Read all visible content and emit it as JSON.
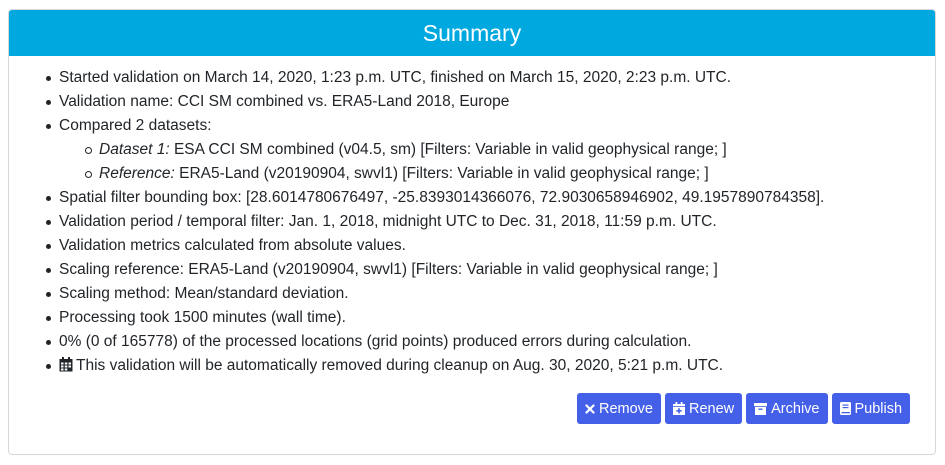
{
  "header": {
    "title": "Summary"
  },
  "summary": {
    "started": "Started validation on March 14, 2020, 1:23 p.m. UTC, finished on March 15, 2020, 2:23 p.m. UTC.",
    "name": "Validation name: CCI SM combined vs. ERA5-Land 2018, Europe",
    "compared": "Compared 2 datasets:",
    "dataset1_label": "Dataset 1:",
    "dataset1_text": " ESA CCI SM combined (v04.5, sm) [Filters: Variable in valid geophysical range; ]",
    "reference_label": "Reference:",
    "reference_text": " ERA5-Land (v20190904, swvl1) [Filters: Variable in valid geophysical range; ]",
    "bbox": "Spatial filter bounding box: [28.6014780676497, -25.8393014366076, 72.9030658946902, 49.1957890784358].",
    "period": "Validation period / temporal filter: Jan. 1, 2018, midnight UTC to Dec. 31, 2018, 11:59 p.m. UTC.",
    "metrics": "Validation metrics calculated from absolute values.",
    "scaling_ref": "Scaling reference: ERA5-Land (v20190904, swvl1) [Filters: Variable in valid geophysical range; ]",
    "scaling_method": "Scaling method: Mean/standard deviation.",
    "processing": "Processing took 1500 minutes (wall time).",
    "errors": "0% (0 of 165778) of the processed locations (grid points) produced errors during calculation.",
    "cleanup": "This validation will be automatically removed during cleanup on Aug. 30, 2020, 5:21 p.m. UTC."
  },
  "actions": {
    "remove": "Remove",
    "renew": "Renew",
    "archive": "Archive",
    "publish": "Publish"
  },
  "colors": {
    "header_bg": "#00a8e0",
    "button_bg": "#4560e8"
  },
  "icons": {
    "remove": "times-icon",
    "renew": "calendar-plus-icon",
    "archive": "archive-icon",
    "publish": "book-icon",
    "cleanup": "calendar-icon"
  }
}
